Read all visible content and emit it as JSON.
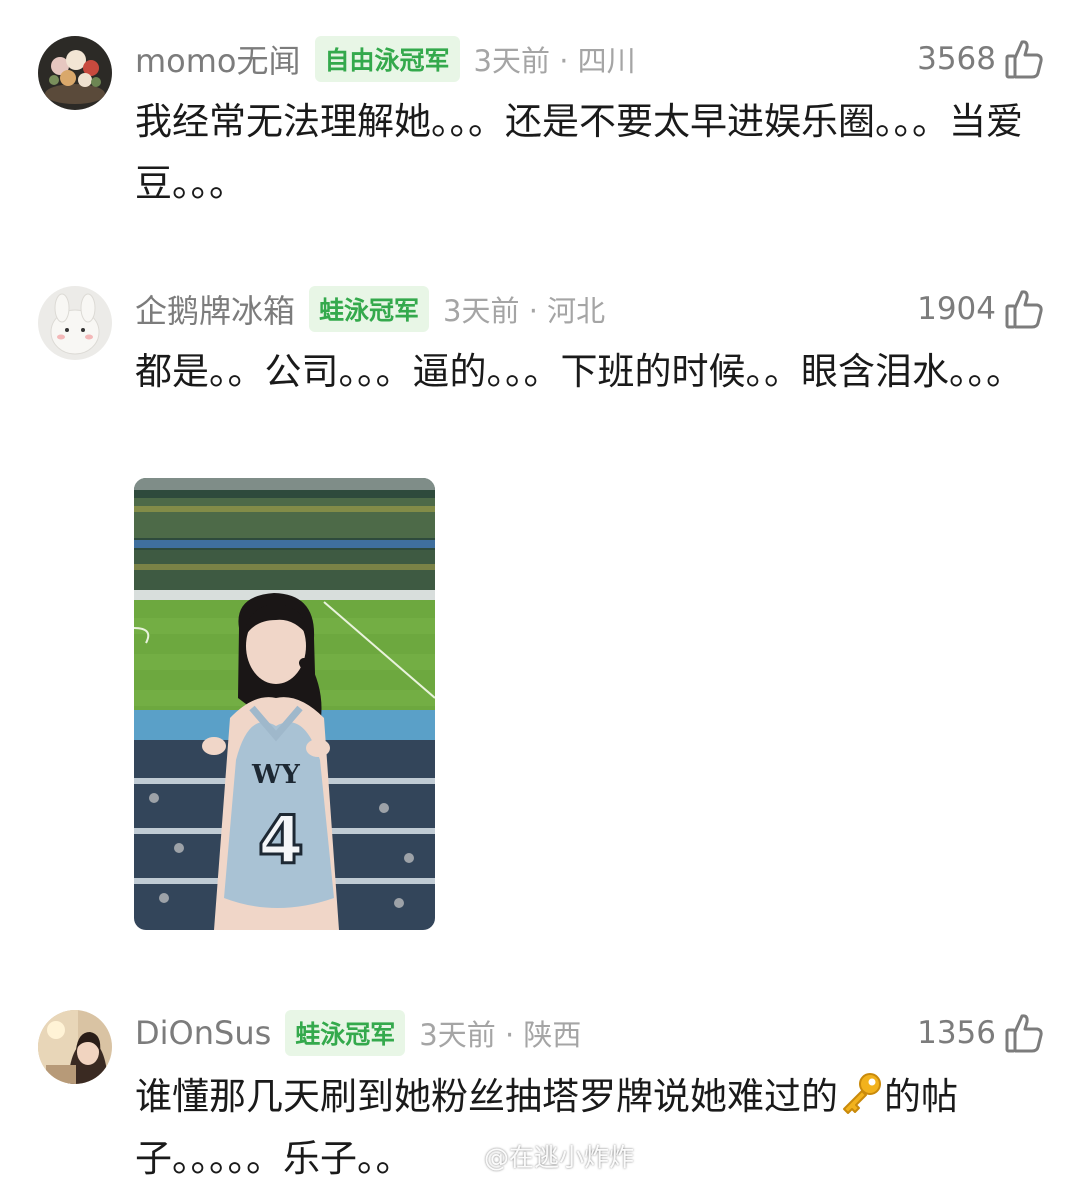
{
  "comments": [
    {
      "username": "momo无闻",
      "badge": "自由泳冠军",
      "time_location": "3天前 · 四川",
      "likes": "3568",
      "text": "我经常无法理解她。。。还是不要太早进娱乐圈。。。当爱豆。。。"
    },
    {
      "username": "企鹅牌冰箱",
      "badge": "蛙泳冠军",
      "time_location": "3天前 · 河北",
      "likes": "1904",
      "text": "都是。。公司。。。逼的。。。下班的时候。。眼含泪水。。。",
      "image": {
        "jersey_text": "WY",
        "jersey_number": "4"
      }
    },
    {
      "username": "DiOnSus",
      "badge": "蛙泳冠军",
      "time_location": "3天前 · 陕西",
      "likes": "1356",
      "text_before_emoji": "谁懂那几天刷到她粉丝抽塔罗牌说她难过的",
      "emoji": "key-emoji",
      "text_after_emoji": "的帖子。。。。。乐子。。"
    }
  ],
  "watermark": "@在逃小炸炸",
  "colors": {
    "badge_text": "#34a94c",
    "badge_bg": "#e8f6e6",
    "meta_gray": "#a5a5a5",
    "name_gray": "#7c7c7c"
  }
}
